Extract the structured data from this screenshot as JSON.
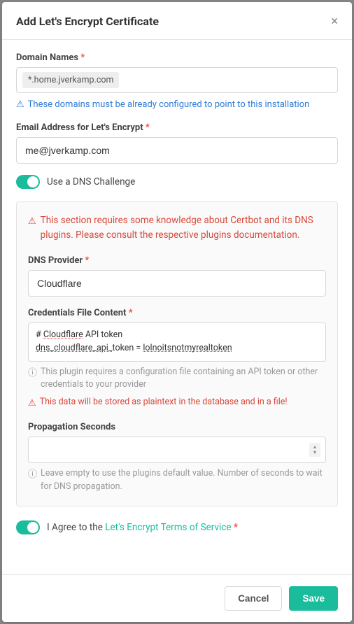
{
  "modal": {
    "title": "Add Let's Encrypt Certificate"
  },
  "domainNames": {
    "label": "Domain Names",
    "tag": "*.home.jverkamp.com",
    "info": "These domains must be already configured to point to this installation"
  },
  "email": {
    "label": "Email Address for Let's Encrypt",
    "value": "me@jverkamp.com"
  },
  "dnsToggle": {
    "label": "Use a DNS Challenge"
  },
  "dnsSection": {
    "warning": "This section requires some knowledge about Certbot and its DNS plugins. Please consult the respective plugins documentation.",
    "provider": {
      "label": "DNS Provider",
      "value": "Cloudflare"
    },
    "credentials": {
      "label": "Credentials File Content",
      "line1_a": "# ",
      "line1_b": "Cloudflare",
      "line1_c": " API token",
      "line2_a": "dns_cloudflare_api_",
      "line2_b": "token = ",
      "line2_c": "lolnoitsnotmyrealtoken",
      "helper": "This plugin requires a configuration file containing an API token or other credentials to your provider",
      "warn": "This data will be stored as plaintext in the database and in a file!"
    },
    "propagation": {
      "label": "Propagation Seconds",
      "value": "",
      "helper": "Leave empty to use the plugins default value. Number of seconds to wait for DNS propagation."
    }
  },
  "agree": {
    "prefix": "I Agree to the ",
    "link": "Let's Encrypt Terms of Service"
  },
  "footer": {
    "cancel": "Cancel",
    "save": "Save"
  }
}
